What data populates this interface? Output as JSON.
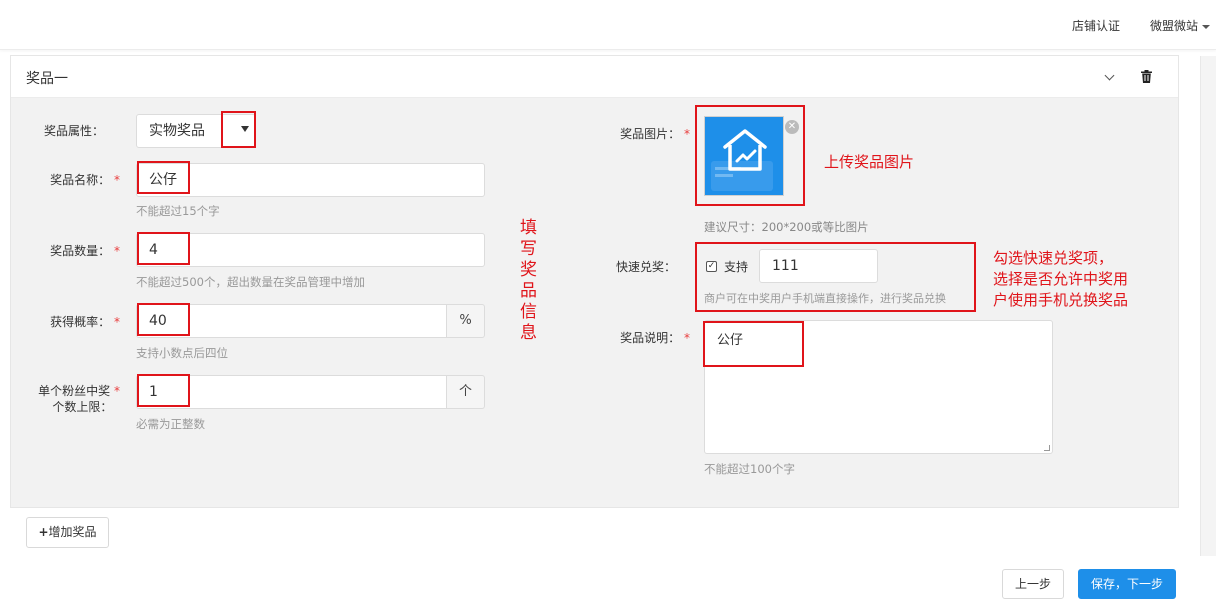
{
  "topbar": {
    "shop_cert": "店铺认证",
    "account": "微盟微站"
  },
  "panel": {
    "title": "奖品一"
  },
  "form": {
    "attr": {
      "label": "奖品属性：",
      "value": "实物奖品"
    },
    "name": {
      "label": "奖品名称：",
      "value": "公仔",
      "hint": "不能超过15个字"
    },
    "quantity": {
      "label": "奖品数量：",
      "value": "4",
      "hint": "不能超过500个，超出数量在奖品管理中增加"
    },
    "probability": {
      "label": "获得概率：",
      "value": "40",
      "unit": "%",
      "hint": "支持小数点后四位"
    },
    "limit": {
      "label_line1": "单个粉丝中奖",
      "label_line2": "个数上限：",
      "value": "1",
      "unit": "个",
      "hint": "必需为正整数"
    },
    "image": {
      "label": "奖品图片：",
      "hint": "建议尺寸：200*200或等比图片"
    },
    "quick": {
      "label": "快速兑奖：",
      "checkbox_label": "支持",
      "value": "111",
      "hint": "商户可在中奖用户手机端直接操作，进行奖品兑换"
    },
    "desc": {
      "label": "奖品说明：",
      "value": "公仔",
      "hint": "不能超过100个字"
    }
  },
  "required_mark": "*",
  "annotations": {
    "fill_info": "填写奖品信息",
    "upload": "上传奖品图片",
    "quick_line1": "勾选快速兑奖项，",
    "quick_line2": "选择是否允许中奖用",
    "quick_line3": "户使用手机兑换奖品"
  },
  "buttons": {
    "add": "增加奖品",
    "prev": "上一步",
    "next": "保存，下一步"
  },
  "colors": {
    "accent": "#1e8fe9",
    "annotation": "#e0141a",
    "required": "#e83c3c"
  }
}
